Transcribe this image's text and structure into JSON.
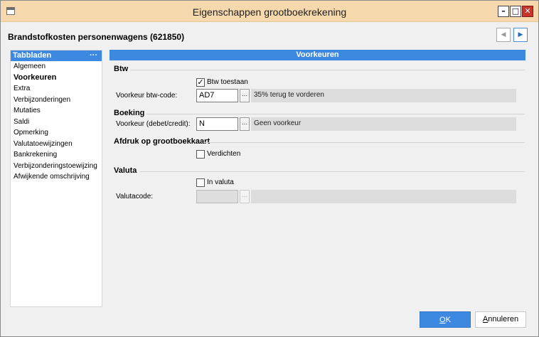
{
  "window": {
    "title": "Eigenschappen grootboekrekening",
    "heading": "Brandstofkosten personenwagens (621850)",
    "min_glyph": "–",
    "max_glyph": "□",
    "close_glyph": "✕",
    "prev_glyph": "◀",
    "next_glyph": "▶"
  },
  "sidebar": {
    "title": "Tabbladen",
    "more": "···",
    "items": [
      {
        "label": "Algemeen"
      },
      {
        "label": "Voorkeuren"
      },
      {
        "label": "Extra"
      },
      {
        "label": "Verbijzonderingen"
      },
      {
        "label": "Mutaties"
      },
      {
        "label": "Saldi"
      },
      {
        "label": "Opmerking"
      },
      {
        "label": "Valutatoewijzingen"
      },
      {
        "label": "Bankrekening"
      },
      {
        "label": "Verbijzonderingstoewijzing"
      },
      {
        "label": "Afwijkende omschrijving"
      }
    ],
    "selected": "Voorkeuren"
  },
  "panel": {
    "title": "Voorkeuren",
    "btw": {
      "section": "Btw",
      "allow_label": "Btw toestaan",
      "allow_checked": true,
      "code_label": "Voorkeur btw-code:",
      "code_value": "AD7",
      "code_desc": "35% terug te vorderen"
    },
    "boeking": {
      "section": "Boeking",
      "label": "Voorkeur (debet/credit):",
      "value": "N",
      "desc": "Geen voorkeur"
    },
    "afdruk": {
      "section": "Afdruk op grootboekkaart",
      "compress_label": "Verdichten",
      "compress_checked": false
    },
    "valuta": {
      "section": "Valuta",
      "in_valuta_label": "In valuta",
      "in_valuta_checked": false,
      "code_label": "Valutacode:",
      "code_value": "",
      "code_desc": ""
    },
    "lookup_glyph": "..."
  },
  "footer": {
    "ok_label": "OK",
    "cancel_label": "Annuleren"
  },
  "colors": {
    "titlebar": "#f5d9ad",
    "accent": "#3d88e1",
    "close": "#c7352b"
  },
  "check_glyph": "✓"
}
